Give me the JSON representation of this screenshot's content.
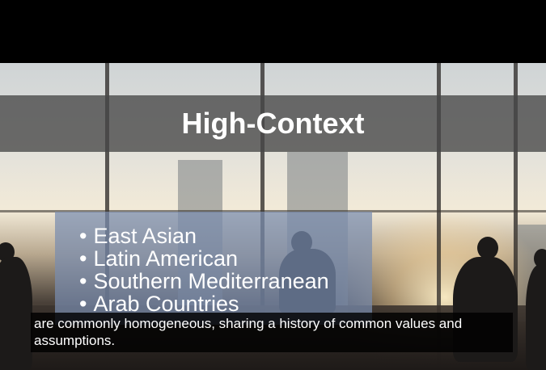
{
  "slide": {
    "title": "High-Context",
    "bullets": [
      "East Asian",
      "Latin American",
      "Southern Mediterranean",
      "Arab Countries"
    ],
    "title_band_color": "#464646",
    "panel_color": "#788caf"
  },
  "caption": {
    "text": "are commonly homogeneous, sharing a history of common values and assumptions."
  }
}
